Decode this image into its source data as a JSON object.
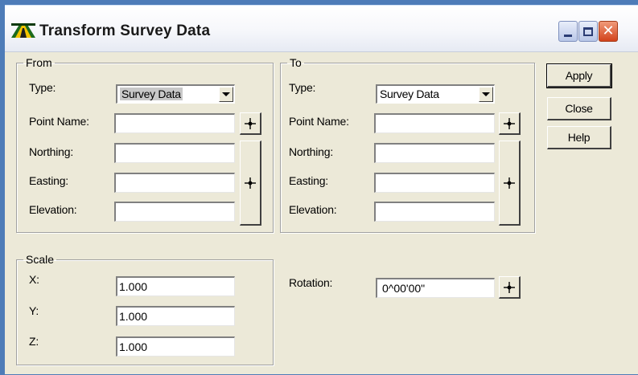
{
  "window": {
    "title": "Transform Survey Data",
    "controls": {
      "minimize": "_",
      "maximize": "□",
      "close": "✕"
    }
  },
  "from": {
    "legend": "From",
    "type_label": "Type:",
    "type_value": "Survey Data",
    "point_name_label": "Point Name:",
    "point_name_value": "",
    "northing_label": "Northing:",
    "northing_value": "",
    "easting_label": "Easting:",
    "easting_value": "",
    "elevation_label": "Elevation:",
    "elevation_value": ""
  },
  "to": {
    "legend": "To",
    "type_label": "Type:",
    "type_value": "Survey Data",
    "point_name_label": "Point Name:",
    "point_name_value": "",
    "northing_label": "Northing:",
    "northing_value": "",
    "easting_label": "Easting:",
    "easting_value": "",
    "elevation_label": "Elevation:",
    "elevation_value": ""
  },
  "scale": {
    "legend": "Scale",
    "x_label": "X:",
    "x_value": "1.000",
    "y_label": "Y:",
    "y_value": "1.000",
    "z_label": "Z:",
    "z_value": "1.000"
  },
  "rotation": {
    "label": "Rotation:",
    "value": "0^00'00\""
  },
  "buttons": {
    "apply": "Apply",
    "close": "Close",
    "help": "Help"
  },
  "icons": {
    "app": "road-app-icon",
    "pick": "crosshair-pick-icon"
  },
  "colors": {
    "dialog_bg": "#ece9d8",
    "desktop_bg": "#4e7cb8",
    "close_button": "#d2431c"
  }
}
